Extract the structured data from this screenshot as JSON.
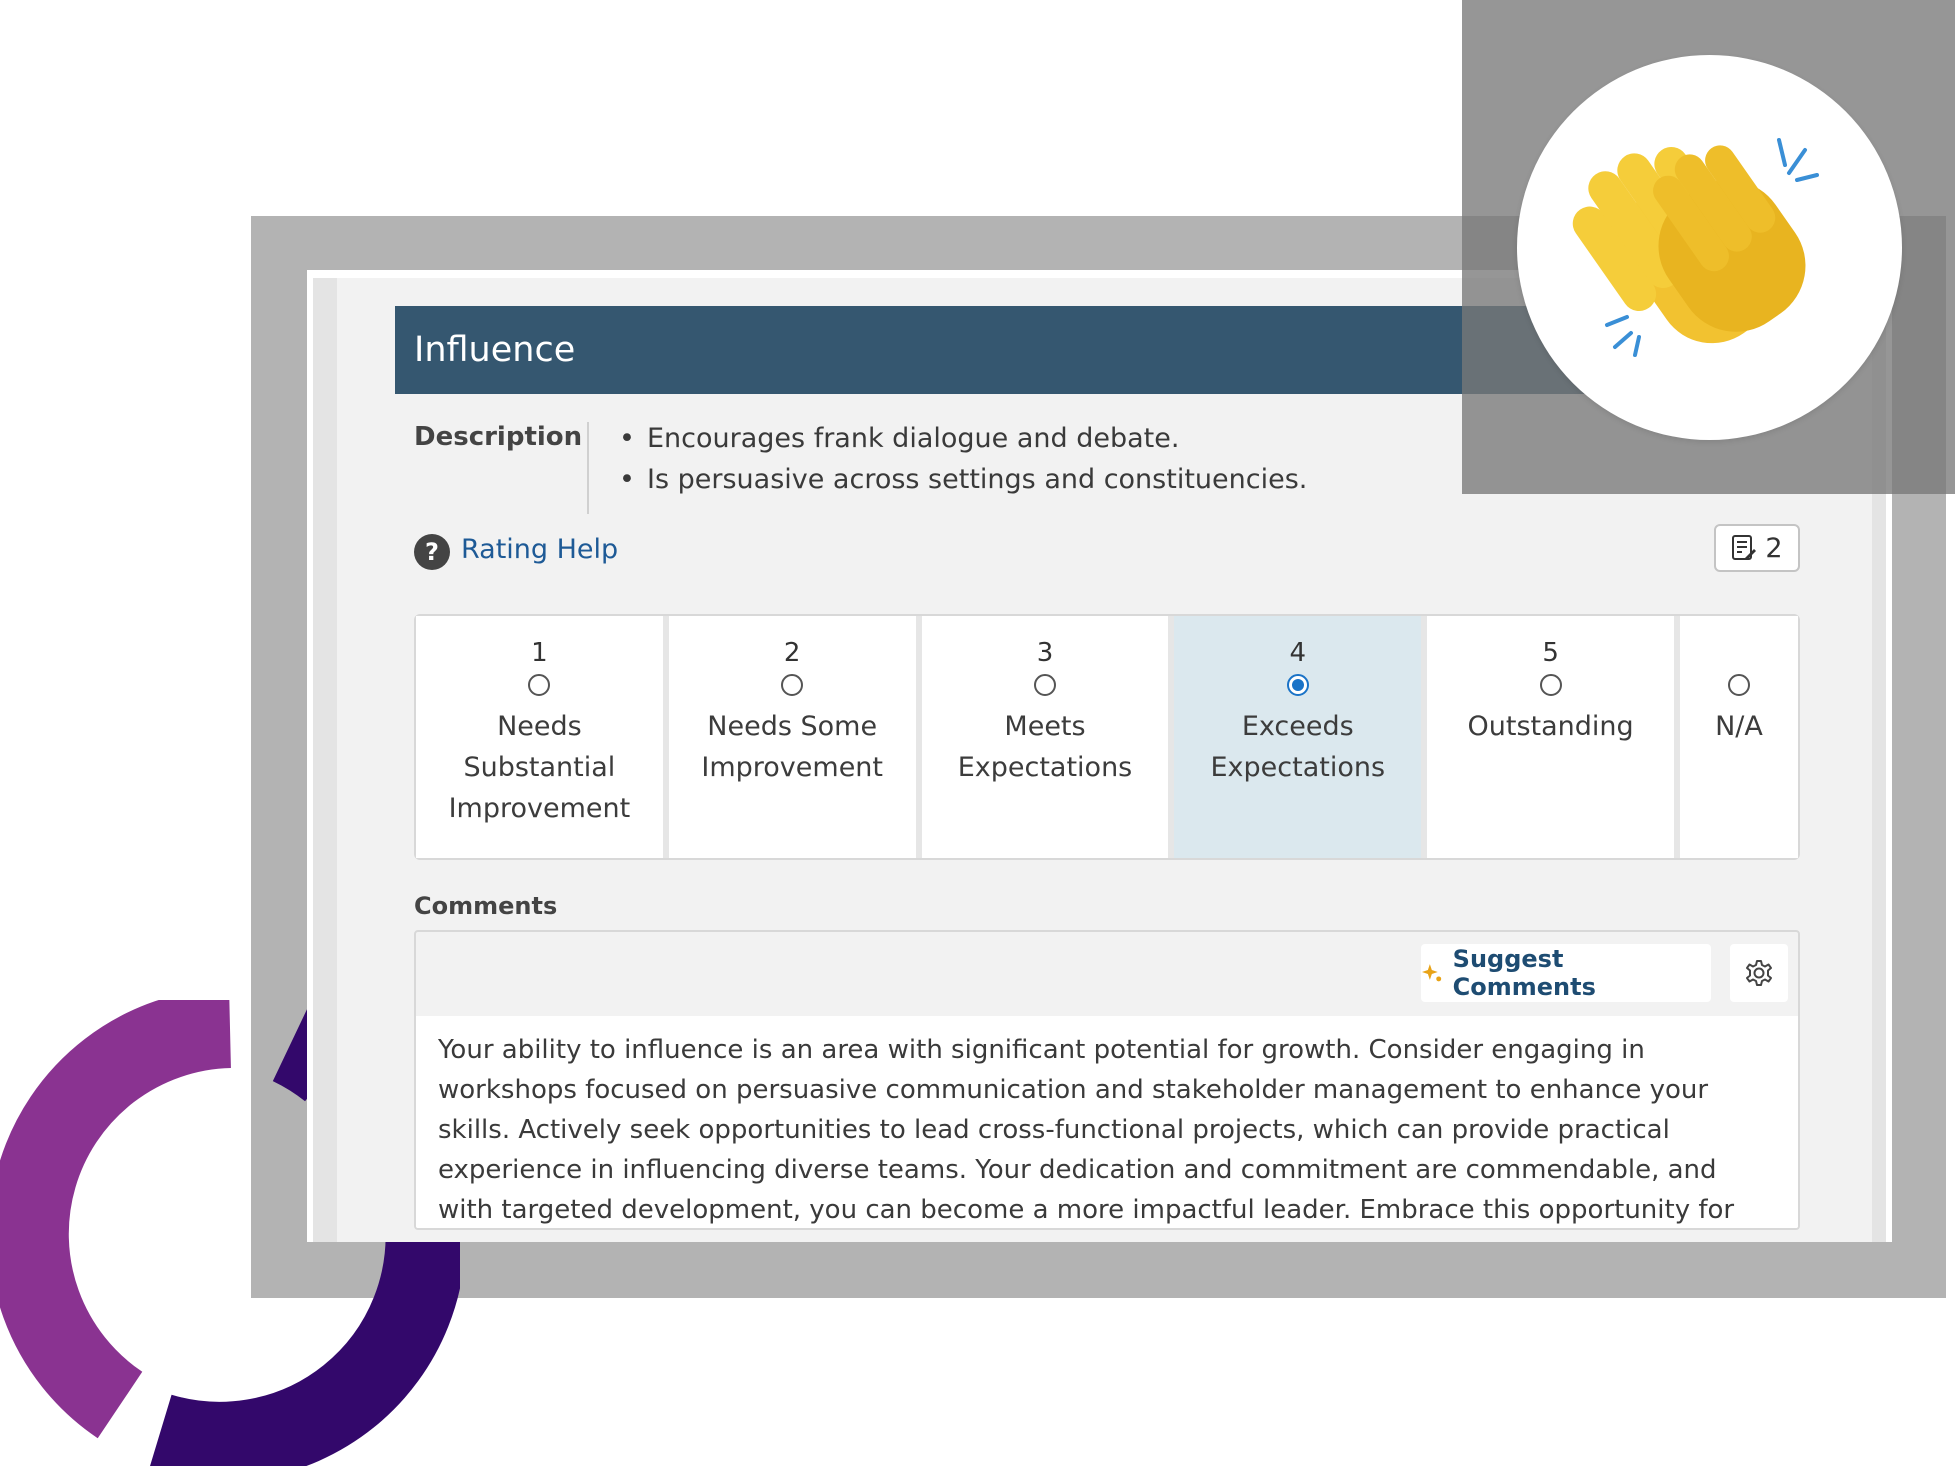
{
  "section": {
    "title": "Influence",
    "description_label": "Description",
    "description_items": [
      "Encourages frank dialogue and debate.",
      "Is persuasive across settings and constituencies."
    ]
  },
  "rating_help": {
    "icon_glyph": "?",
    "label": "Rating Help",
    "notes_count": "2"
  },
  "ratings": [
    {
      "number": "1",
      "label": "Needs Substantial Improvement",
      "selected": false
    },
    {
      "number": "2",
      "label": "Needs Some Improvement",
      "selected": false
    },
    {
      "number": "3",
      "label": "Meets Expectations",
      "selected": false
    },
    {
      "number": "4",
      "label": "Exceeds Expectations",
      "selected": true
    },
    {
      "number": "5",
      "label": "Outstanding",
      "selected": false
    },
    {
      "number": "",
      "label": "N/A",
      "selected": false
    }
  ],
  "comments": {
    "title": "Comments",
    "suggest_label": "Suggest Comments",
    "text": "Your ability to influence is an area with significant potential for growth. Consider engaging in workshops focused on persuasive communication and stakeholder management to enhance your skills. Actively seek opportunities to lead cross-functional projects, which can provide practical experience in influencing diverse teams. Your dedication and commitment are commendable, and with targeted development, you can become a more impactful leader. Embrace this opportunity for growth, as your potential to inspire and"
  },
  "colors": {
    "header_bg": "#355770",
    "selected_bg": "#dbe8ee",
    "link": "#1e5a96",
    "radio_checked": "#1a73c7",
    "ring_light": "#8a3391",
    "ring_dark": "#33086b"
  },
  "icons": {
    "clap": "clapping-hands-icon",
    "notes": "note-edit-icon",
    "sparkle": "sparkle-icon",
    "gear": "gear-icon"
  }
}
